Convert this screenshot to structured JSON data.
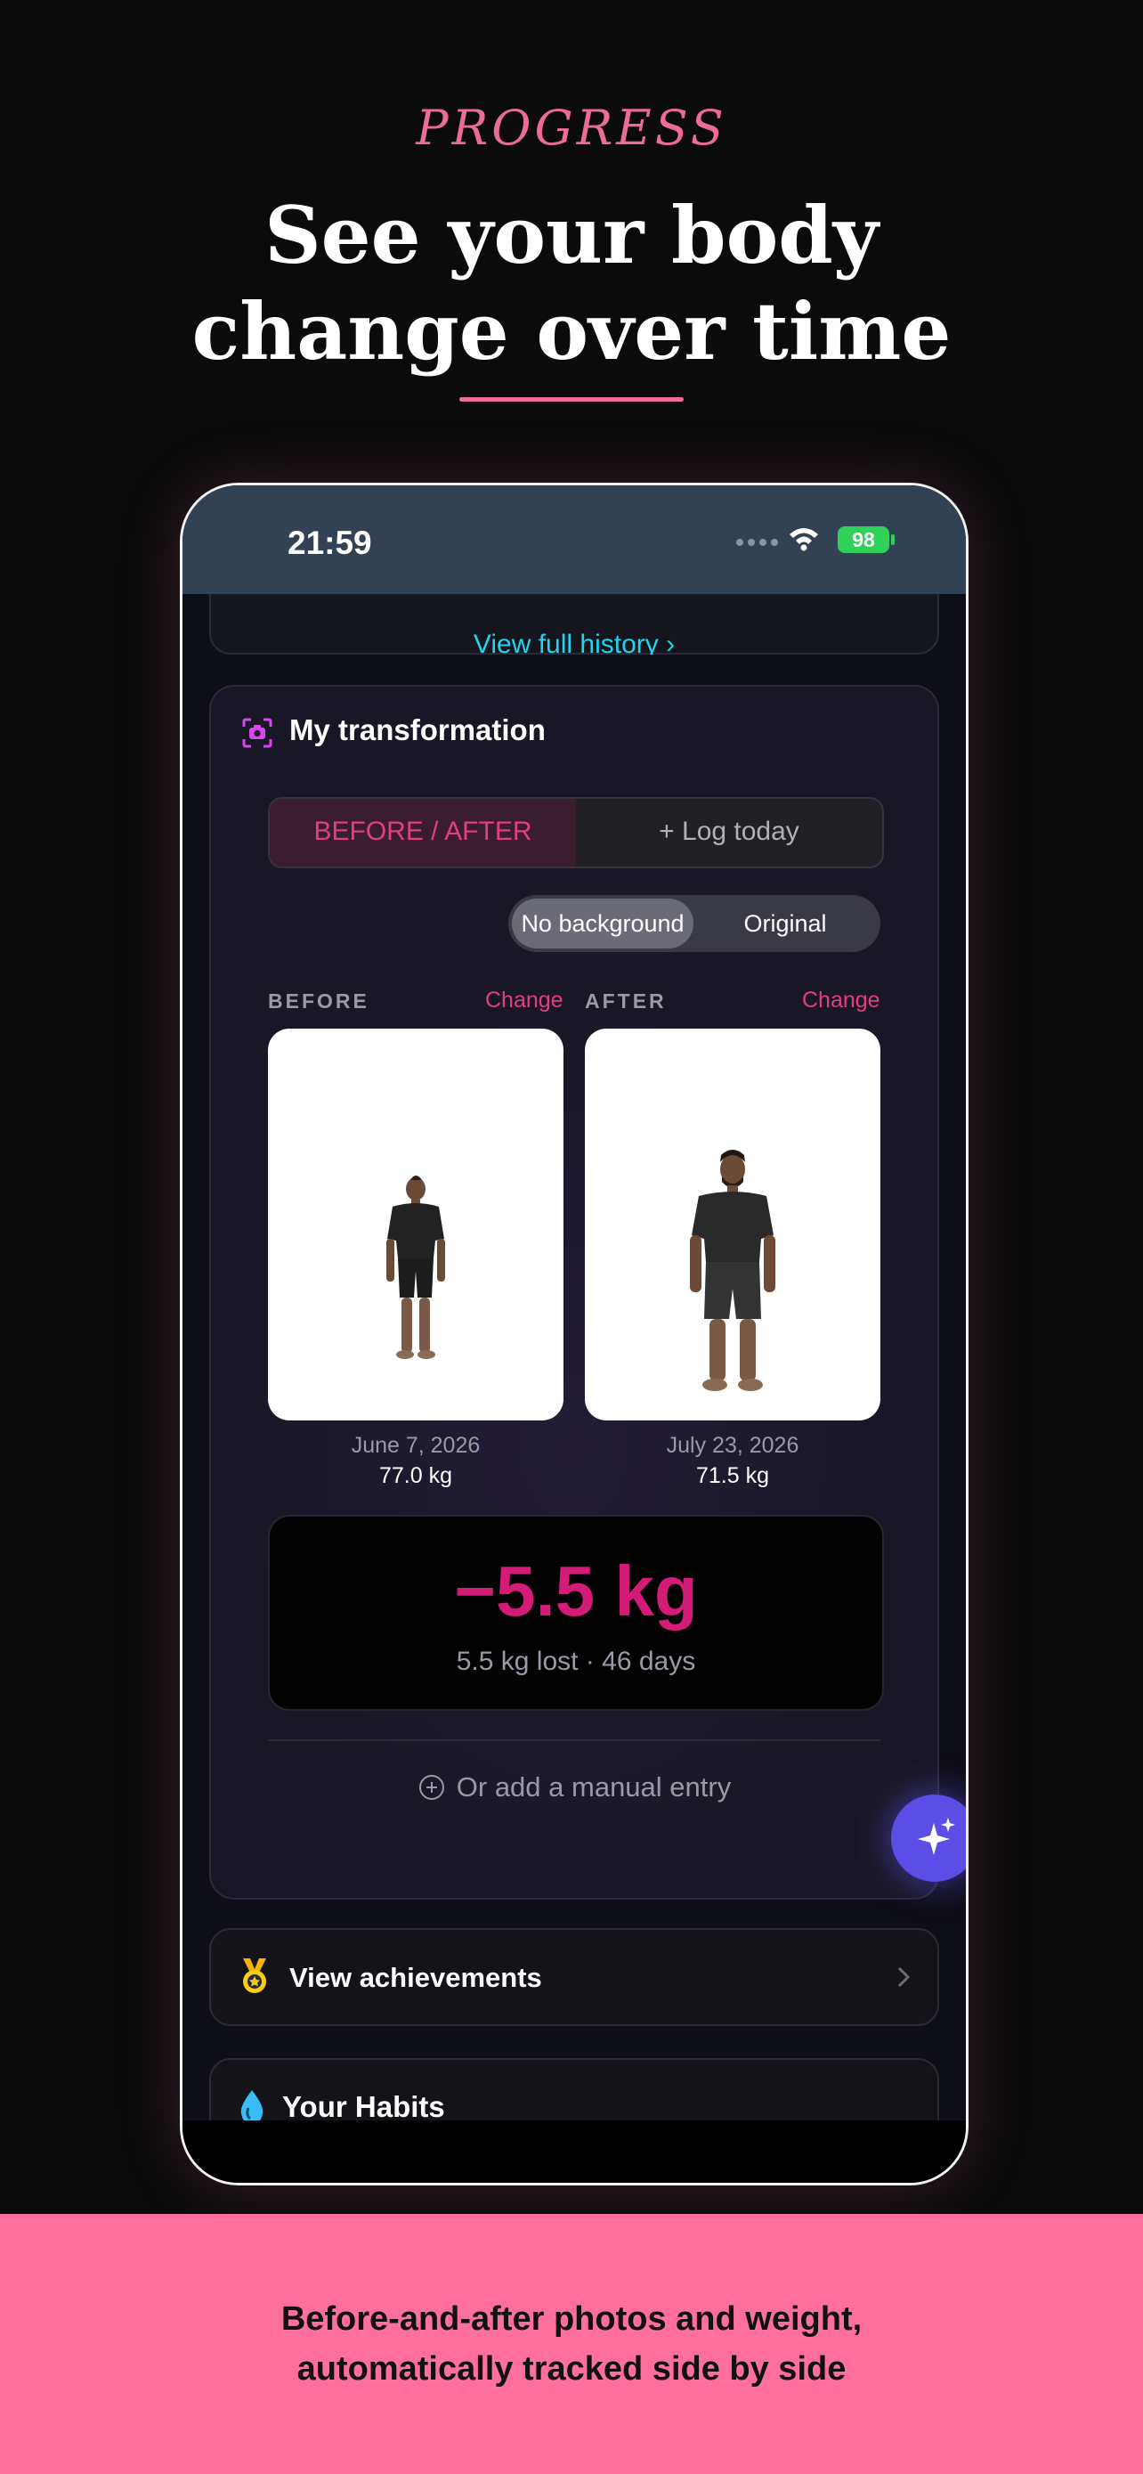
{
  "marketing": {
    "kicker": "PROGRESS",
    "headline_line1": "See your body",
    "headline_line2": "change over time",
    "caption_line1": "Before-and-after photos and weight,",
    "caption_line2": "automatically tracked side by side",
    "accent_color": "#ec6b99"
  },
  "status_bar": {
    "time": "21:59",
    "battery": "98"
  },
  "history": {
    "link_label": "View full history ›"
  },
  "transformation": {
    "title": "My transformation",
    "tabs": [
      {
        "label": "BEFORE / AFTER",
        "active": true
      },
      {
        "label": "+ Log today",
        "active": false
      }
    ],
    "background_toggle": [
      {
        "label": "No background",
        "active": true
      },
      {
        "label": "Original",
        "active": false
      }
    ],
    "before": {
      "label": "BEFORE",
      "change_label": "Change",
      "date": "June 7, 2026",
      "weight": "77.0 kg"
    },
    "after": {
      "label": "AFTER",
      "change_label": "Change",
      "date": "July 23, 2026",
      "weight": "71.5 kg"
    },
    "delta": {
      "value": "−5.5 kg",
      "summary": "5.5 kg lost · 46 days"
    },
    "manual_entry_label": "Or add a manual entry"
  },
  "achievements": {
    "label": "View achievements"
  },
  "habits": {
    "title": "Your Habits"
  },
  "colors": {
    "pink_accent": "#e0407f",
    "delta_color": "#d41b78",
    "link_cyan": "#22d3ee",
    "fab_purple": "#5b4de6"
  }
}
